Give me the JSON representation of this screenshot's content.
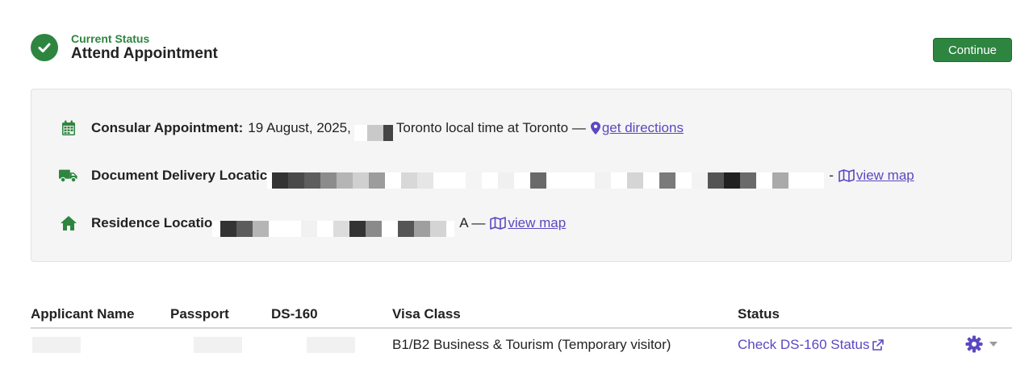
{
  "header": {
    "kicker": "Current Status",
    "title": "Attend Appointment",
    "continue_label": "Continue"
  },
  "appointment": {
    "consular_label": "Consular Appointment:",
    "consular_value_start": "19 August, 2025,",
    "consular_value_end": "Toronto local time at Toronto —",
    "directions_link": "get directions",
    "delivery_label": "Document Delivery Locatic",
    "delivery_suffix": "-",
    "delivery_map_link": "view map",
    "residence_label": "Residence Locatio",
    "residence_suffix": "A —",
    "residence_map_link": "view map"
  },
  "table": {
    "columns": [
      "Applicant Name",
      "Passport",
      "DS-160",
      "Visa Class",
      "Status"
    ],
    "rows": [
      {
        "visa_class": "B1/B2 Business & Tourism (Temporary visitor)",
        "status_link": "Check DS-160 Status"
      }
    ]
  },
  "colors": {
    "accent_green": "#2e8540",
    "link_purple": "#5b48c2",
    "panel_bg": "#f5f5f5"
  },
  "icons": [
    "check-circle-icon",
    "calendar-icon",
    "map-pin-icon",
    "truck-icon",
    "map-icon",
    "home-icon",
    "external-link-icon",
    "gear-icon",
    "caret-down-icon"
  ]
}
